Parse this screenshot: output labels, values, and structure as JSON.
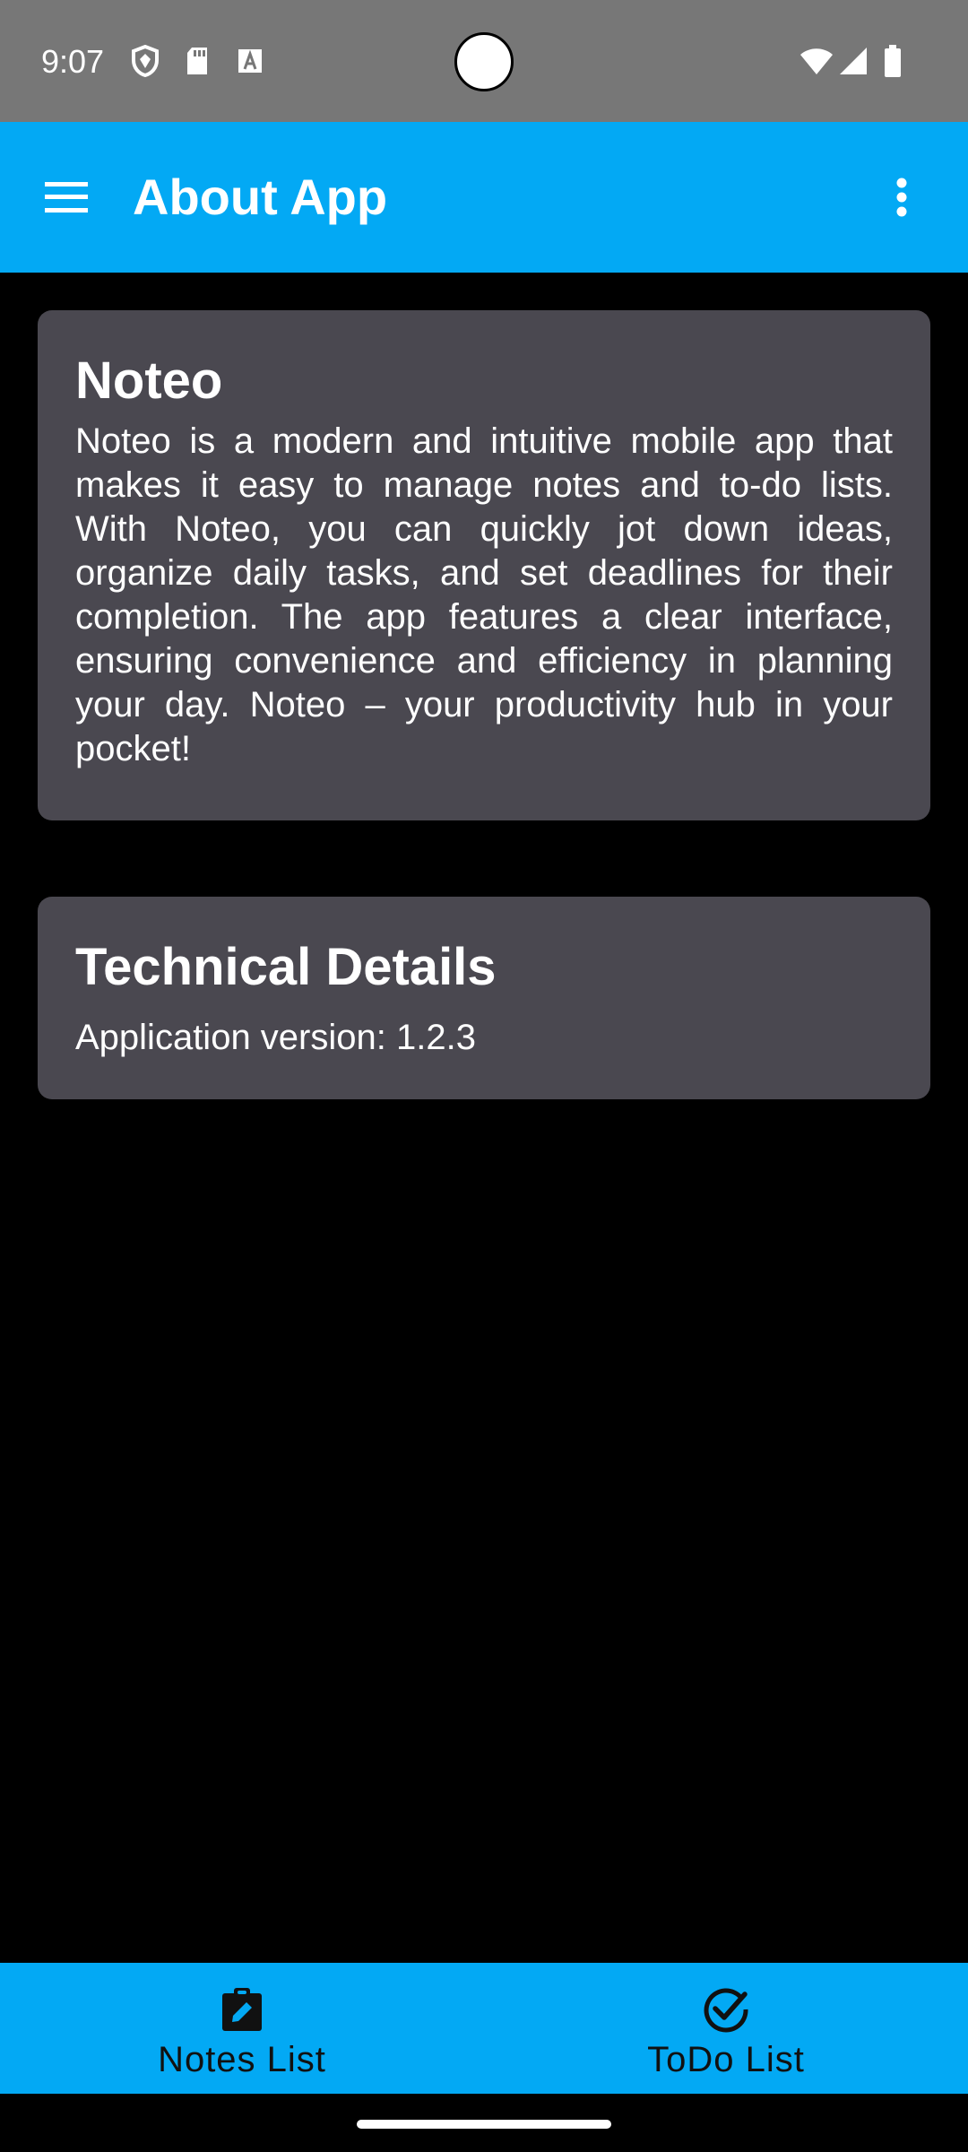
{
  "status_bar": {
    "time": "9:07",
    "icons": [
      "shield-icon",
      "sd-card-icon",
      "text-a-icon",
      "wifi-icon",
      "signal-icon",
      "battery-icon"
    ]
  },
  "app_bar": {
    "title": "About App",
    "background": "#03A9F4",
    "menu_icon": "hamburger-menu-icon",
    "overflow_icon": "more-vert-icon"
  },
  "about_card": {
    "title": "Noteo",
    "body": "Noteo is a modern and intuitive mobile app that makes it easy to manage notes and to-do lists. With Noteo, you can quickly jot down ideas, organize daily tasks, and set deadlines for their completion. The app features a clear interface, ensuring convenience and efficiency in planning your day. Noteo – your productivity hub in your pocket!"
  },
  "tech_card": {
    "title": "Technical Details",
    "version_line": "Application version: 1.2.3"
  },
  "bottom_nav": {
    "items": [
      {
        "label": "Notes List",
        "icon": "edit-clipboard-icon"
      },
      {
        "label": "ToDo List",
        "icon": "check-circle-icon"
      }
    ]
  },
  "colors": {
    "accent": "#03A9F4",
    "card": "#4A4850",
    "status_bar": "#777777",
    "background": "#000000"
  }
}
